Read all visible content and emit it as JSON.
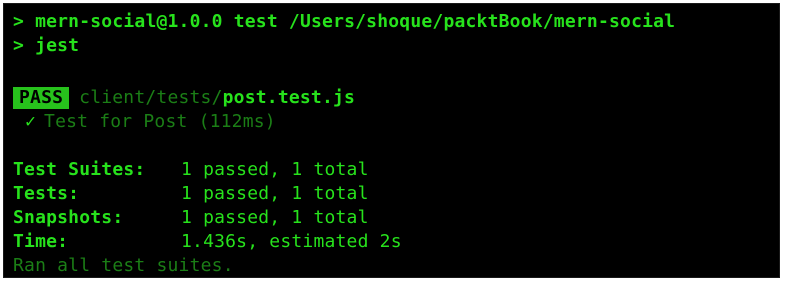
{
  "command": {
    "line1": "> mern-social@1.0.0 test /Users/shoque/packtBook/mern-social",
    "line2": "> jest"
  },
  "result": {
    "badge": "PASS",
    "path_dir": "client/tests/",
    "path_file": "post.test.js",
    "check_symbol": "✓",
    "test_name": "Test for Post (112ms)"
  },
  "summary": {
    "suites_label": "Test Suites:",
    "suites_value": "1 passed, 1 total",
    "tests_label": "Tests:",
    "tests_value": "1 passed, 1 total",
    "snapshots_label": "Snapshots:",
    "snapshots_value": "1 passed, 1 total",
    "time_label": "Time:",
    "time_value": "1.436s, estimated 2s",
    "footer": "Ran all test suites."
  },
  "colors": {
    "background": "#000000",
    "text_bright": "#27e21c",
    "text_dim": "#1b7e16",
    "badge_bg": "#27c21c"
  }
}
